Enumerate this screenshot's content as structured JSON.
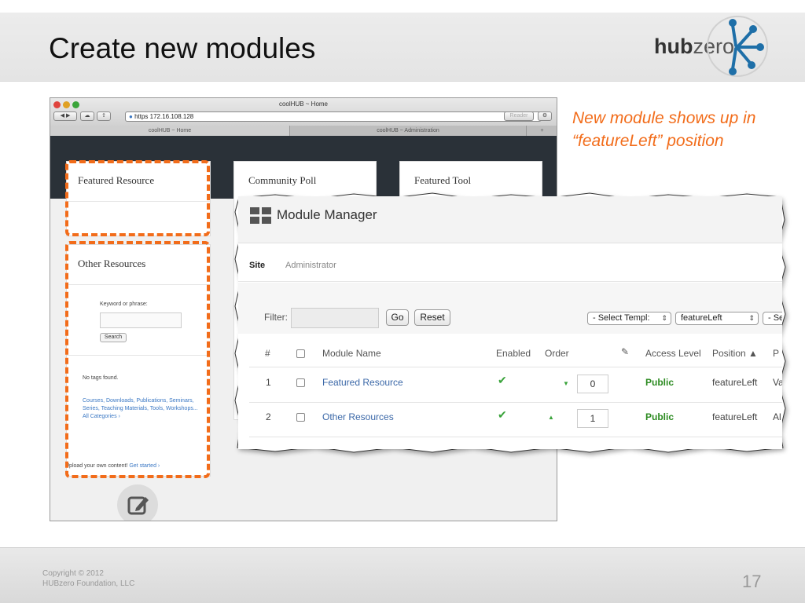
{
  "slide": {
    "title": "Create new modules",
    "logo": {
      "hub": "hub",
      "zero": "zero"
    },
    "callout": "New module shows up in “featureLeft” position",
    "page_number": "17",
    "copyright": {
      "line1": "Copyright © 2012",
      "line2": "HUBzero Foundation, LLC"
    }
  },
  "browser": {
    "window_title": "coolHUB ~ Home",
    "url": "https 172.16.108.128",
    "reader_label": "Reader",
    "tabs": [
      "coolHUB ~ Home",
      "coolHUB ~ Administration",
      "+"
    ],
    "panels": {
      "featured_resource": "Featured Resource",
      "community_poll": "Community Poll",
      "featured_tool": "Featured Tool",
      "other_resources": "Other Resources"
    },
    "keyword_label": "Keyword or phrase:",
    "search_label": "Search",
    "no_tags": "No tags found.",
    "categories_text": "Courses, Downloads, Publications, Seminars, Series, Teaching Materials, Tools, Workshops... All Categories ›",
    "upload_text": "Upload your own content!",
    "get_started": "Get started ›"
  },
  "module_manager": {
    "title": "Module Manager",
    "tabs": [
      "Site",
      "Administrator"
    ],
    "filter_label": "Filter:",
    "go_label": "Go",
    "reset_label": "Reset",
    "select_template": "- Select Templ:",
    "position_select": "featureLeft",
    "third_select": "- Se",
    "columns": [
      "#",
      "Module Name",
      "Enabled",
      "Order",
      "Access Level",
      "Position ▲",
      "P"
    ],
    "rows": [
      {
        "num": "1",
        "name": "Featured Resource",
        "order_value": "0",
        "access": "Public",
        "position": "featureLeft",
        "extra": "Va"
      },
      {
        "num": "2",
        "name": "Other Resources",
        "order_value": "1",
        "access": "Public",
        "position": "featureLeft",
        "extra": "Al"
      }
    ]
  },
  "colors": {
    "accent": "#f26c1a",
    "link": "#3b68a8",
    "public": "#2c8b21",
    "check": "#39a33a"
  }
}
